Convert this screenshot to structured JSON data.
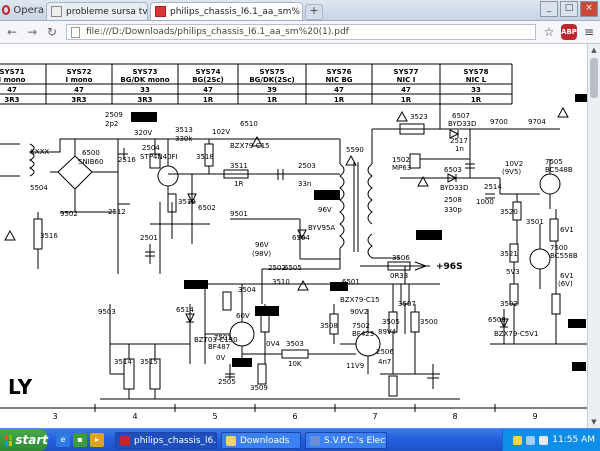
{
  "browser": {
    "menu_label": "Opera",
    "tabs": [
      {
        "label": "probleme sursa tv philips l6",
        "active": false
      },
      {
        "label": "philips_chassis_l6.1_aa_sm%",
        "active": true
      }
    ],
    "url": "file:///D:/Downloads/philips_chassis_l6.1_aa_sm%20(1).pdf",
    "abp_label": "ABP"
  },
  "schematic": {
    "header_columns": [
      "SYS71",
      "SYS72",
      "SYS73",
      "SYS74",
      "SYS75",
      "SYS76",
      "SYS77",
      "SYS78"
    ],
    "header_sub": [
      "I mono",
      "I mono",
      "BG/DK mono",
      "BG(2Sc)",
      "BG/DK(2Sc)",
      "NIC BG",
      "NIC I",
      "NIC L"
    ],
    "row1": [
      "47",
      "47",
      "33",
      "47",
      "39",
      "47",
      "47",
      "33"
    ],
    "row2": [
      "3R3",
      "3R3",
      "3R3",
      "1R",
      "1R",
      "1R",
      "1R",
      "1R"
    ],
    "bottom_ruler": [
      "3",
      "4",
      "5",
      "6",
      "7",
      "8",
      "9"
    ],
    "labels": {
      "l2509": "2509",
      "l2510": "2p2",
      "l320v": "320V",
      "l3513": "3513",
      "l330k": "330k",
      "l6510": "6510",
      "lbzx79": "BZX79-C15",
      "l102v": "102V",
      "l6500": "6500",
      "lsnib": "SNIB60",
      "l5504": "5504",
      "lxxxx": "XXXX",
      "l2516": "2516",
      "l9502": "9502",
      "l2512": "2512",
      "l3516": "3516",
      "l2504": "2504",
      "lstp": "STP4N40FI",
      "l3518": "3518",
      "l3511": "3511",
      "l1r": "1R",
      "l2503": "2503",
      "l33n": "33n",
      "l5590": "5590",
      "l3512": "3512",
      "l6502": "6502",
      "l9501": "9501",
      "l96v": "96V",
      "l96v2": "96V",
      "l98v": "(98V)",
      "l6504": "6504",
      "lbyv": "BYV95A",
      "l3523": "3523",
      "l6507": "6507",
      "lbyd33d": "BYD33D",
      "l2517": "2517",
      "l1n": "1n",
      "l1502": "1502",
      "lmp63": "MP63",
      "l6503": "6503",
      "lbyd33d2": "BYD33D",
      "l2508": "2508",
      "l330p": "330p",
      "l9700": "9700",
      "l9704": "9704",
      "l10v2": "10V2",
      "l9v5": "(9V5)",
      "l7505": "7505",
      "lbc548": "BC548B",
      "l3506": "3506",
      "l0r33": "0R33",
      "l96s": "+96S",
      "l6501": "6501",
      "lbzx15": "BZX79-C15",
      "l9502b": "9503",
      "l6514": "6514",
      "lbzt": "BZT03-C130",
      "l7501": "7501",
      "lbf487": "BF487",
      "l60v": "60V",
      "l0v4": "0V4",
      "l0v": "0V",
      "l3503": "3503",
      "l10k": "10K",
      "l90v2": "90V2",
      "l7502": "7502",
      "lbf423": "BF423",
      "l89v4": "89V4",
      "l11v9": "11V9",
      "l2506": "2506",
      "l4n7": "4n7",
      "l3514": "3514",
      "l3515": "3515",
      "l2505": "2505",
      "l3509": "3509",
      "l3508": "3508",
      "l3507": "3507",
      "l3505": "3505",
      "l3500": "3500",
      "l3502": "3502",
      "l6v1": "6V1",
      "l7500": "7500",
      "lbc558": "BC558B",
      "l5v3": "5V3",
      "l6v1b": "6V1",
      "l6v": "(6V)",
      "l6500b": "6508",
      "lbzx5v1": "BZX79-C5V1",
      "l3520": "3520",
      "l3521": "3521",
      "l2514": "2514",
      "l1000": "1000",
      "l3501": "3501",
      "l2501": "2501",
      "lly": "LY",
      "l3504": "3504",
      "l3510": "3510",
      "l2502": "2502",
      "l6505": "6505"
    }
  },
  "taskbar": {
    "start_label": "start",
    "tasks": [
      {
        "label": "philips_chassis_l6.1_...",
        "active": true
      },
      {
        "label": "Downloads",
        "active": false
      },
      {
        "label": "S.V.P.C.'s Electro",
        "active": false
      }
    ],
    "clock": "11:55 AM"
  }
}
